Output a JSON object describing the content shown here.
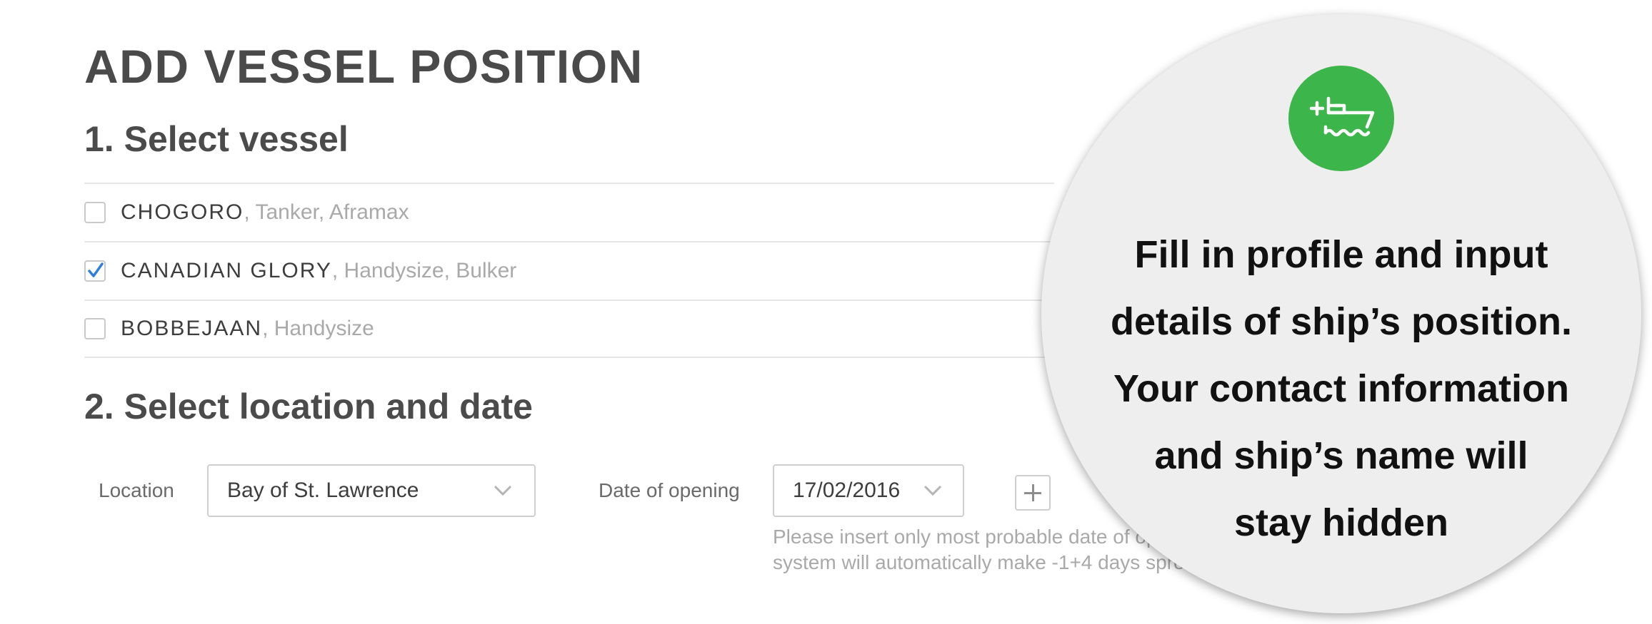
{
  "page": {
    "title": "ADD VESSEL POSITION"
  },
  "section1": {
    "title": "1. Select vessel"
  },
  "vessels": [
    {
      "name": "CHOGORO",
      "meta": ", Tanker, Aframax",
      "checked": false
    },
    {
      "name": "CANADIAN GLORY",
      "meta": ", Handysize, Bulker",
      "checked": true
    },
    {
      "name": "BOBBEJAAN",
      "meta": ", Handysize",
      "checked": false
    }
  ],
  "section2": {
    "title": "2. Select location and date"
  },
  "location": {
    "label": "Location",
    "value": "Bay of St. Lawrence"
  },
  "date": {
    "label": "Date of opening",
    "value": "17/02/2016"
  },
  "hint": {
    "line1": "Please insert only most probable date of op",
    "line2": "system will automatically make -1+4 days spre"
  },
  "callout": {
    "icon": "add-ship-icon",
    "lines": [
      "Fill in profile and input",
      "details of ship’s position.",
      "Your contact information",
      "and ship’s name will",
      "stay hidden"
    ]
  },
  "colors": {
    "accent_green": "#3cb54a",
    "checkmark_blue": "#2f7fe0"
  }
}
